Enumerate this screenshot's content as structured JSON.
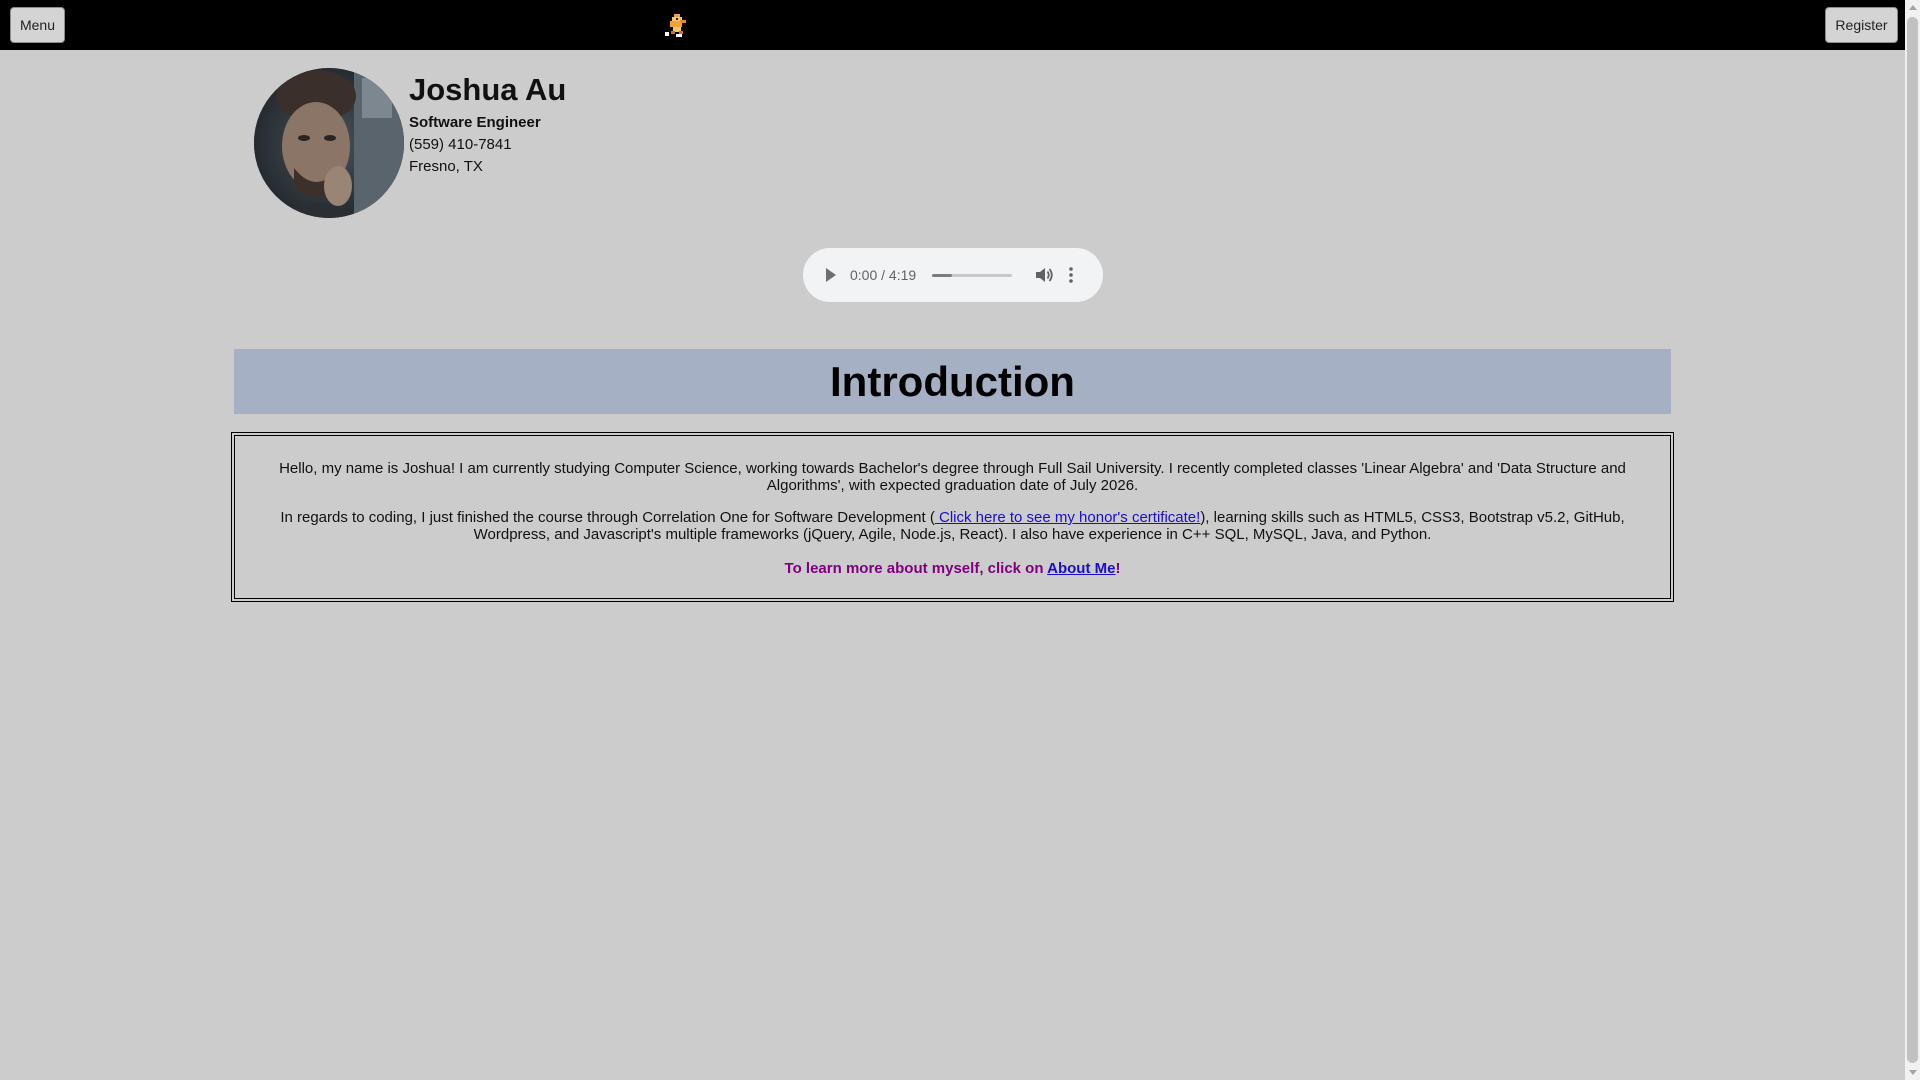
{
  "topbar": {
    "menu_label": "Menu",
    "register_label": "Register",
    "logo_icon": "pixel-sprite-logo-icon"
  },
  "profile": {
    "name": "Joshua Au",
    "title": "Software Engineer",
    "phone": "(559) 410-7841",
    "location": "Fresno, TX",
    "avatar_icon": "profile-photo"
  },
  "audio": {
    "time": "0:00 / 4:19",
    "progress": 0.0
  },
  "intro": {
    "heading": "Introduction",
    "paragraph1": "Hello, my name is Joshua! I am currently studying Computer Science, working towards Bachelor's degree through Full Sail University. I recently completed classes 'Linear Algebra' and 'Data Structure and Algorithms', with expected graduation date of July 2026.",
    "paragraph2_before": "In regards to coding, I just finished the course through Correlation One for Software Development (",
    "certificate_link": " Click here to see my honor's certificate!",
    "paragraph2_after": "), learning skills such as HTML5, CSS3, Bootstrap v5.2, GitHub, Wordpress, and Javascript's multiple frameworks (jQuery, Agile, Node.js, React). I also have experience in C++ SQL, MySQL, Java, and Python.",
    "learn_more_prefix": "To learn more about myself, click on ",
    "about_link": "About Me",
    "learn_more_suffix": "!"
  },
  "colors": {
    "background": "#cccccc",
    "topbar": "#000000",
    "intro_header": "#a6b0c4",
    "link": "#1a0dcc",
    "learn_more": "#800080"
  }
}
